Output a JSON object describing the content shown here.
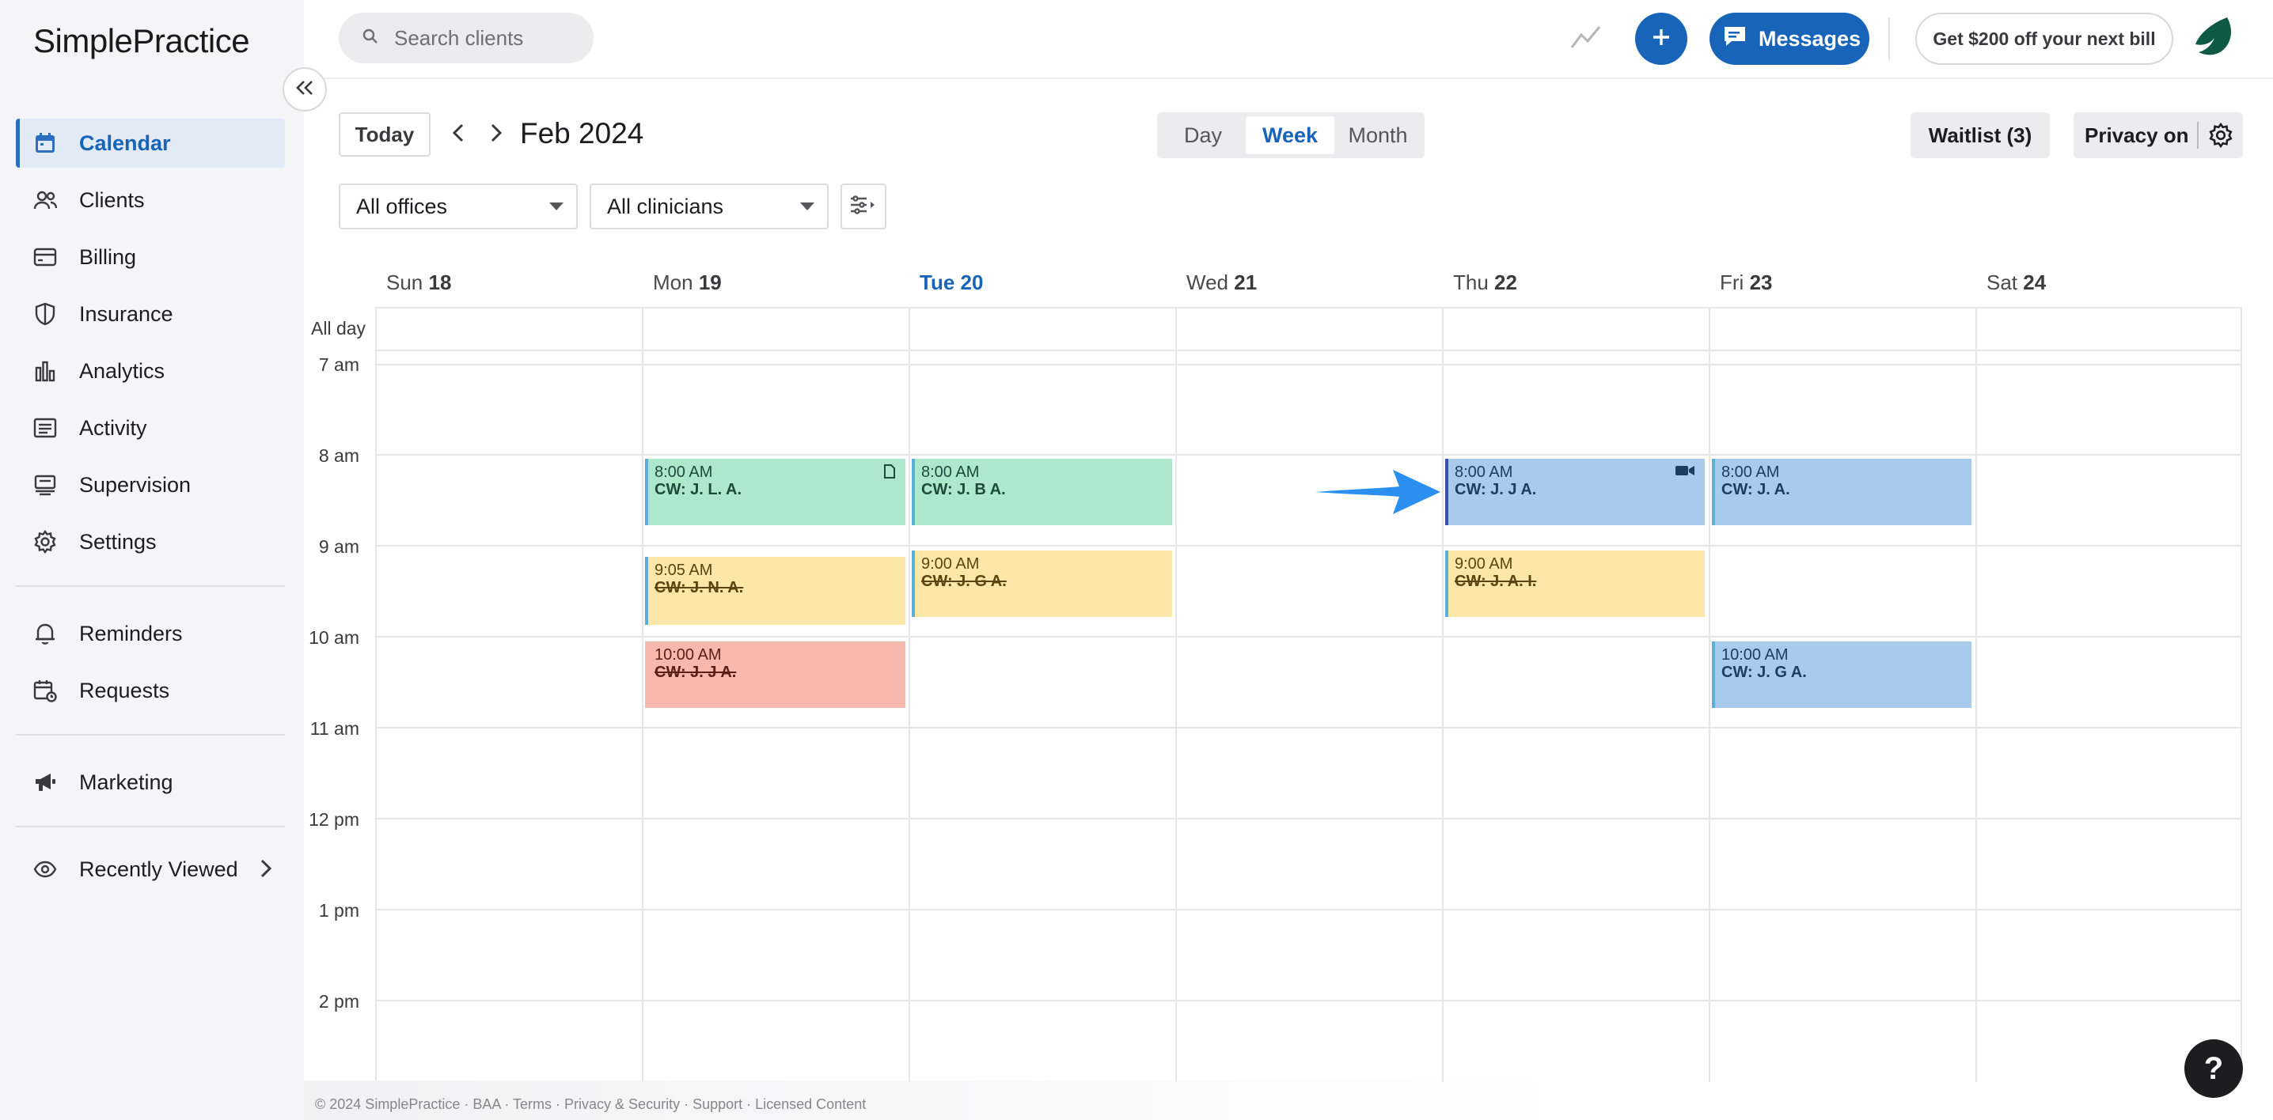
{
  "app": {
    "logo": "SimplePractice"
  },
  "sidebar": {
    "items": [
      {
        "label": "Calendar",
        "icon": "calendar-icon",
        "active": true
      },
      {
        "label": "Clients",
        "icon": "users-icon"
      },
      {
        "label": "Billing",
        "icon": "credit-card-icon"
      },
      {
        "label": "Insurance",
        "icon": "shield-icon"
      },
      {
        "label": "Analytics",
        "icon": "bar-chart-icon"
      },
      {
        "label": "Activity",
        "icon": "list-icon"
      },
      {
        "label": "Supervision",
        "icon": "supervision-icon"
      },
      {
        "label": "Settings",
        "icon": "gear-icon"
      },
      {
        "label": "Reminders",
        "icon": "bell-icon"
      },
      {
        "label": "Requests",
        "icon": "calendar-request-icon"
      },
      {
        "label": "Marketing",
        "icon": "megaphone-icon"
      },
      {
        "label": "Recently Viewed",
        "icon": "eye-icon"
      }
    ]
  },
  "topbar": {
    "search_placeholder": "Search clients",
    "messages_label": "Messages",
    "promo_label": "Get $200 off your next bill"
  },
  "toolbar": {
    "today_label": "Today",
    "month_title": "Feb 2024",
    "views": [
      "Day",
      "Week",
      "Month"
    ],
    "active_view": "Week",
    "waitlist_label": "Waitlist (3)",
    "privacy_label": "Privacy on",
    "offices_select": "All offices",
    "clinicians_select": "All clinicians"
  },
  "calendar": {
    "days": [
      {
        "dow": "Sun",
        "num": "18"
      },
      {
        "dow": "Mon",
        "num": "19"
      },
      {
        "dow": "Tue",
        "num": "20",
        "today": true
      },
      {
        "dow": "Wed",
        "num": "21"
      },
      {
        "dow": "Thu",
        "num": "22"
      },
      {
        "dow": "Fri",
        "num": "23"
      },
      {
        "dow": "Sat",
        "num": "24"
      }
    ],
    "allday_label": "All day",
    "times": [
      "7 am",
      "8 am",
      "9 am",
      "10 am",
      "11 am",
      "12 pm",
      "1 pm",
      "2 pm"
    ],
    "events": [
      {
        "time": "8:00 AM",
        "name": "CW: J. L. A.",
        "color": "green",
        "day": "Mon",
        "icon": "note-icon"
      },
      {
        "time": "9:05 AM",
        "name": "CW: J. N. A.",
        "color": "yellow",
        "day": "Mon",
        "cancelled": true
      },
      {
        "time": "10:00 AM",
        "name": "CW: J. J A.",
        "color": "red",
        "day": "Mon",
        "cancelled": true
      },
      {
        "time": "8:00 AM",
        "name": "CW: J. B A.",
        "color": "green",
        "day": "Tue"
      },
      {
        "time": "9:00 AM",
        "name": "CW: J. G A.",
        "color": "yellow",
        "day": "Tue",
        "cancelled": true
      },
      {
        "time": "8:00 AM",
        "name": "CW: J. J A.",
        "color": "blue",
        "day": "Thu",
        "icon": "video-icon"
      },
      {
        "time": "9:00 AM",
        "name": "CW: J. A. I.",
        "color": "yellow",
        "day": "Thu",
        "cancelled": true
      },
      {
        "time": "8:00 AM",
        "name": "CW: J. A.",
        "color": "blue",
        "day": "Fri"
      },
      {
        "time": "10:00 AM",
        "name": "CW: J. G A.",
        "color": "blue",
        "day": "Fri"
      }
    ]
  },
  "footer": {
    "text": "© 2024 SimplePractice · BAA · Terms · Privacy & Security · Support · Licensed Content"
  },
  "help": {
    "label": "?"
  },
  "colors": {
    "accent": "#1764b8",
    "event_green": "#ade8cd",
    "event_yellow": "#fde7a8",
    "event_red": "#f7b8ad",
    "event_blue": "#a8cbed",
    "arrow": "#2b8ff0"
  }
}
